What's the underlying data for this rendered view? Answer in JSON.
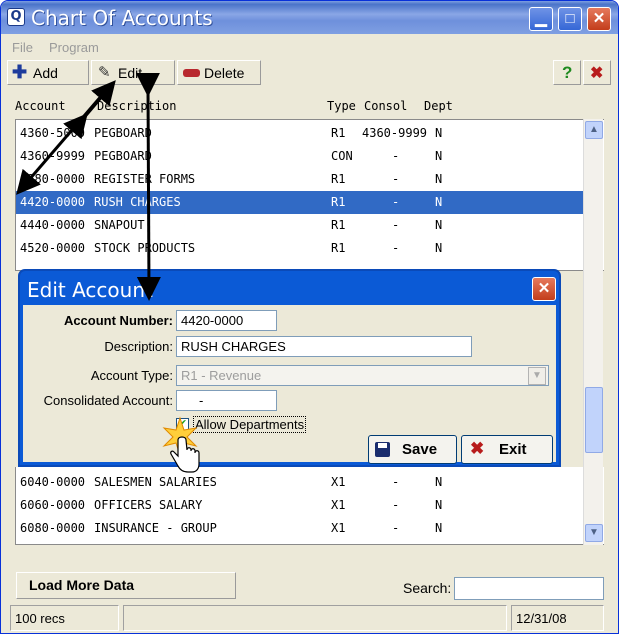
{
  "window": {
    "title": "Chart Of Accounts"
  },
  "menu": [
    "File",
    "Program"
  ],
  "toolbar": {
    "add": "Add",
    "edit": "Edit",
    "delete": "Delete",
    "help": "?",
    "exit": "✖"
  },
  "columns": {
    "account": "Account",
    "description": "Description",
    "type": "Type",
    "consol": "Consol",
    "dept": "Dept"
  },
  "rows_top": [
    {
      "account": "4360-5000",
      "description": "PEGBOARD",
      "type": "R1",
      "consol": "4360-9999",
      "dept": "N"
    },
    {
      "account": "4360-9999",
      "description": "PEGBOARD",
      "type": "CON",
      "consol": "-",
      "dept": "N"
    },
    {
      "account": "4380-0000",
      "description": "REGISTER FORMS",
      "type": "R1",
      "consol": "-",
      "dept": "N"
    },
    {
      "account": "4420-0000",
      "description": "RUSH CHARGES",
      "type": "R1",
      "consol": "-",
      "dept": "N",
      "selected": true
    },
    {
      "account": "4440-0000",
      "description": "SNAPOUT",
      "type": "R1",
      "consol": "-",
      "dept": "N"
    },
    {
      "account": "4520-0000",
      "description": "STOCK PRODUCTS",
      "type": "R1",
      "consol": "-",
      "dept": "N"
    }
  ],
  "rows_bottom": [
    {
      "account": "6040-0000",
      "description": "SALESMEN SALARIES",
      "type": "X1",
      "consol": "-",
      "dept": "N"
    },
    {
      "account": "6060-0000",
      "description": "OFFICERS SALARY",
      "type": "X1",
      "consol": "-",
      "dept": "N"
    },
    {
      "account": "6080-0000",
      "description": "INSURANCE - GROUP",
      "type": "X1",
      "consol": "-",
      "dept": "N"
    }
  ],
  "dialog": {
    "title": "Edit Account",
    "account_number_label": "Account Number:",
    "account_number": "4420-0000",
    "description_label": "Description:",
    "description": "RUSH CHARGES",
    "account_type_label": "Account Type:",
    "account_type": "R1  - Revenue",
    "consolidated_label": "Consolidated Account:",
    "consolidated": "-",
    "allow_departments": "Allow Departments",
    "allow_departments_checked": true,
    "save": "Save",
    "exit": "Exit"
  },
  "footer": {
    "load_more": "Load More Data",
    "search_label": "Search:",
    "search_value": ""
  },
  "status": {
    "records": "100 recs",
    "date": "12/31/08"
  },
  "colors": {
    "titlebar": "#4a74c9",
    "selection": "#316ac5",
    "dialog_frame": "#0b5ad6"
  }
}
